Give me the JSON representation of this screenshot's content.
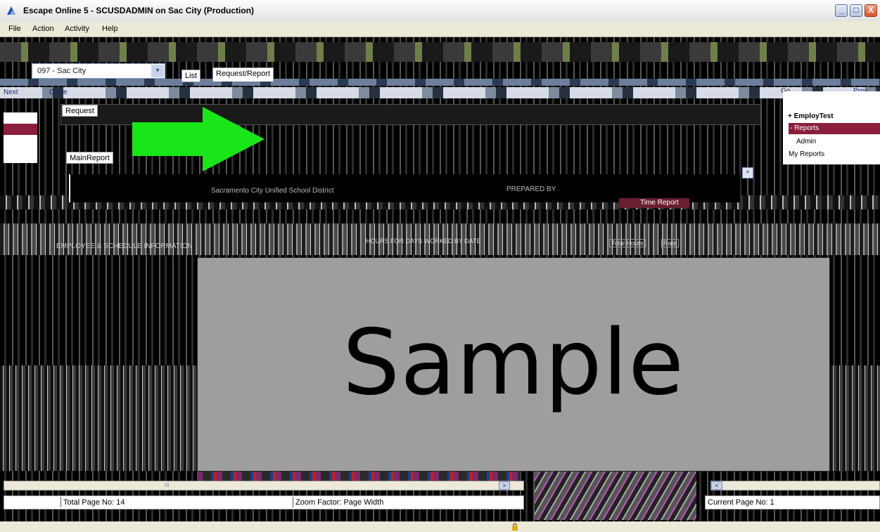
{
  "window": {
    "title": "Escape Online 5 - SCUSDADMIN on Sac City (Production)",
    "minimize_label": "_",
    "maximize_label": "□",
    "close_label": "X"
  },
  "menu": {
    "items": [
      "File",
      "Action",
      "Activity",
      "Help"
    ]
  },
  "district_select": {
    "value": "097 - Sac City",
    "arrow": "▾"
  },
  "toolbar": {
    "next_label": "Next",
    "close_label": "Close",
    "go_label": "Go",
    "prev_label": "Prev"
  },
  "tabs": {
    "list": "List",
    "request_report": "Request/Report",
    "request": "Request",
    "main_report": "MainReport"
  },
  "nav_tree": {
    "items": [
      "+ EmployTest",
      "- Reports",
      "Admin",
      "My Reports"
    ]
  },
  "report": {
    "district_name": "Sacramento City Unified School District",
    "prepared_by": "PREPARED BY",
    "time_report": "Time Report",
    "hours_heading": "HOURS FOR DAYS WORKED BY DATE",
    "section_heading": "EMPLOYEE & SCHEDULE INFORMATION",
    "total_hours": "Total Hours",
    "rate": "Rate"
  },
  "watermark": {
    "text": "Sample"
  },
  "status": {
    "total_pages": "Total Page No: 14",
    "zoom": "Zoom Factor: Page Width",
    "current_page": "Current Page No: 1"
  },
  "scroll": {
    "right": ">",
    "left": "<",
    "up": "^",
    "grip": "III"
  },
  "colors": {
    "arrow": "#19e619",
    "selection": "#8a1e3c",
    "watermark_bg": "#9e9e9e"
  }
}
